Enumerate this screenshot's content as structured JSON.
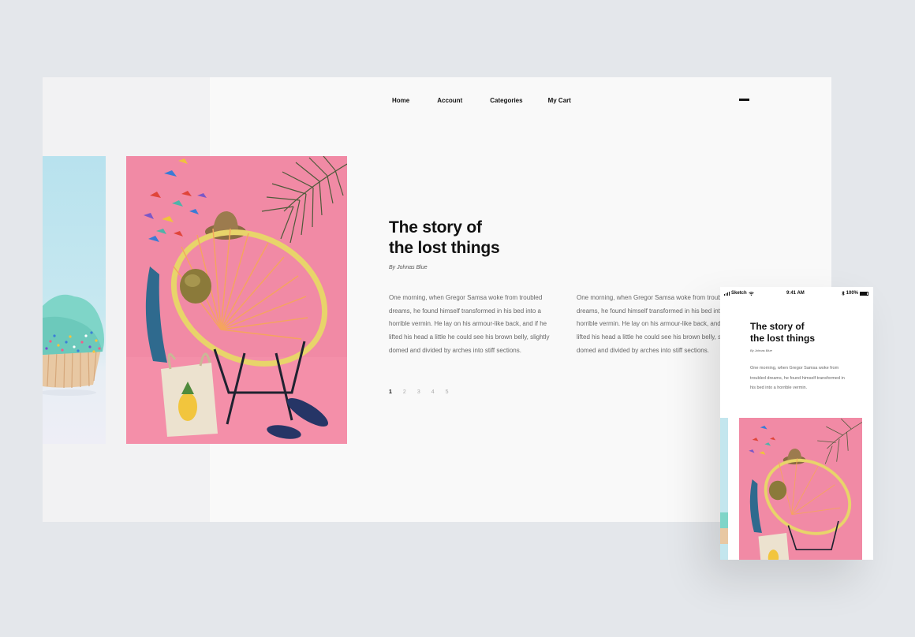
{
  "nav": {
    "items": [
      "Home",
      "Account",
      "Categories",
      "My Cart"
    ]
  },
  "article": {
    "title_line1": "The story of",
    "title_line2": "the lost things",
    "byline": "By Johnas Blue",
    "para1": "One morning, when Gregor Samsa woke from troubled dreams, he found himself transformed in his bed into a horrible vermin. He lay on his armour-like back, and if he lifted his head a little he could see his brown belly, slightly domed and divided by arches into stiff sections.",
    "para2": "One morning, when Gregor Samsa woke from troubled dreams, he found himself transformed in his bed into a horrible vermin. He lay on his armour-like back, and if he lifted his head a little he could see his brown belly, slightly domed and divided by arches into stiff sections."
  },
  "pager": {
    "pages": [
      "1",
      "2",
      "3",
      "4",
      "5"
    ],
    "active": "1"
  },
  "mobile": {
    "carrier": "Sketch",
    "time": "9:41 AM",
    "battery": "100%",
    "title_line1": "The story of",
    "title_line2": "the lost things",
    "byline": "By Johnas Blue",
    "para": "One morning, when Gregor Samsa woke from troubled dreams, he found himself transformed in his bed into a horrible vermin."
  },
  "icons": {
    "menu": "hamburger-menu-icon",
    "signal": "signal-icon",
    "wifi": "wifi-icon",
    "bluetooth": "bluetooth-icon",
    "battery": "battery-icon"
  },
  "colors": {
    "background": "#e4e7eb",
    "page": "#f9f9f9",
    "pink": "#f08aa5",
    "cyan": "#bfe3ec"
  }
}
